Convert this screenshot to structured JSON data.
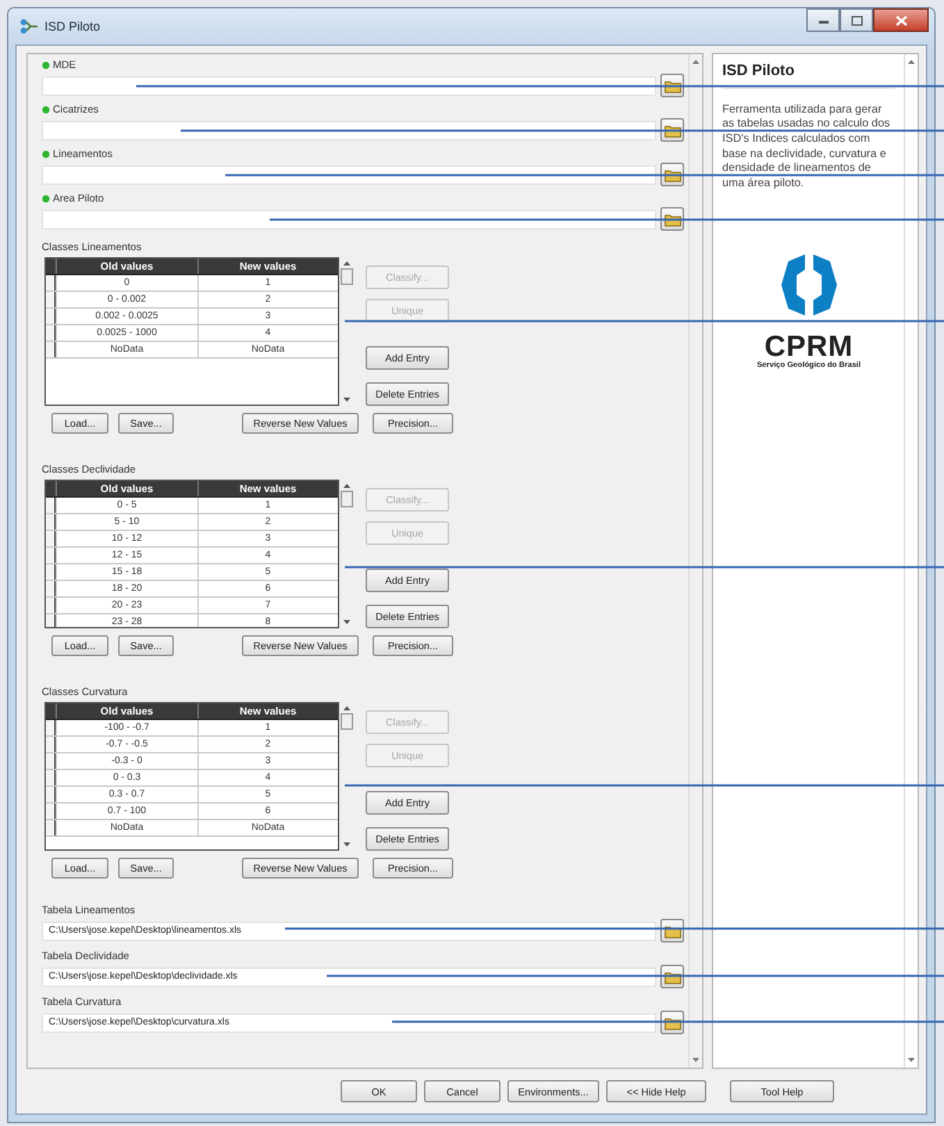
{
  "window": {
    "title": "ISD Piloto"
  },
  "inputs": [
    {
      "label": "MDE",
      "required": true
    },
    {
      "label": "Cicatrizes",
      "required": true
    },
    {
      "label": "Lineamentos",
      "required": true
    },
    {
      "label": "Area Piloto",
      "required": true
    }
  ],
  "reclass_groups": [
    {
      "label": "Classes Lineamentos",
      "columns": [
        "Old values",
        "New values"
      ],
      "rows": [
        {
          "old": "0",
          "new": "1"
        },
        {
          "old": "0 - 0.002",
          "new": "2"
        },
        {
          "old": "0.002 - 0.0025",
          "new": "3"
        },
        {
          "old": "0.0025 - 1000",
          "new": "4"
        },
        {
          "old": "NoData",
          "new": "NoData"
        }
      ],
      "side_buttons": [
        {
          "label": "Classify...",
          "disabled": true
        },
        {
          "label": "Unique",
          "disabled": true
        },
        {
          "label": "Add Entry",
          "disabled": false
        },
        {
          "label": "Delete Entries",
          "disabled": false
        }
      ],
      "bottom_buttons": [
        "Load...",
        "Save...",
        "Reverse New Values",
        "Precision..."
      ]
    },
    {
      "label": "Classes Declividade",
      "columns": [
        "Old values",
        "New values"
      ],
      "rows": [
        {
          "old": "0 - 5",
          "new": "1"
        },
        {
          "old": "5 - 10",
          "new": "2"
        },
        {
          "old": "10 - 12",
          "new": "3"
        },
        {
          "old": "12 - 15",
          "new": "4"
        },
        {
          "old": "15 - 18",
          "new": "5"
        },
        {
          "old": "18 - 20",
          "new": "6"
        },
        {
          "old": "20 - 23",
          "new": "7"
        },
        {
          "old": "23 - 28",
          "new": "8"
        }
      ],
      "side_buttons": [
        {
          "label": "Classify...",
          "disabled": true
        },
        {
          "label": "Unique",
          "disabled": true
        },
        {
          "label": "Add Entry",
          "disabled": false
        },
        {
          "label": "Delete Entries",
          "disabled": false
        }
      ],
      "bottom_buttons": [
        "Load...",
        "Save...",
        "Reverse New Values",
        "Precision..."
      ]
    },
    {
      "label": "Classes Curvatura",
      "columns": [
        "Old values",
        "New values"
      ],
      "rows": [
        {
          "old": "-100 - -0.7",
          "new": "1"
        },
        {
          "old": "-0.7 - -0.5",
          "new": "2"
        },
        {
          "old": "-0.3 - 0",
          "new": "3"
        },
        {
          "old": "0 - 0.3",
          "new": "4"
        },
        {
          "old": "0.3 - 0.7",
          "new": "5"
        },
        {
          "old": "0.7 - 100",
          "new": "6"
        },
        {
          "old": "NoData",
          "new": "NoData"
        }
      ],
      "side_buttons": [
        {
          "label": "Classify...",
          "disabled": true
        },
        {
          "label": "Unique",
          "disabled": true
        },
        {
          "label": "Add Entry",
          "disabled": false
        },
        {
          "label": "Delete Entries",
          "disabled": false
        }
      ],
      "bottom_buttons": [
        "Load...",
        "Save...",
        "Reverse New Values",
        "Precision..."
      ]
    }
  ],
  "output_tables": [
    {
      "label": "Tabela Lineamentos",
      "value": "C:\\Users\\jose.kepel\\Desktop\\lineamentos.xls"
    },
    {
      "label": "Tabela Declividade",
      "value": "C:\\Users\\jose.kepel\\Desktop\\declividade.xls"
    },
    {
      "label": "Tabela Curvatura",
      "value": "C:\\Users\\jose.kepel\\Desktop\\curvatura.xls"
    }
  ],
  "help": {
    "title": "ISD Piloto",
    "text": "Ferramenta utilizada para gerar as tabelas usadas no calculo dos ISD's Indices calculados com base na declividade, curvatura e densidade de lineamentos de uma área piloto.",
    "logo_name": "CPRM",
    "logo_subtitle": "Serviço Geológico do Brasil"
  },
  "footer_buttons": [
    "OK",
    "Cancel",
    "Environments...",
    "<< Hide Help",
    "Tool Help"
  ]
}
